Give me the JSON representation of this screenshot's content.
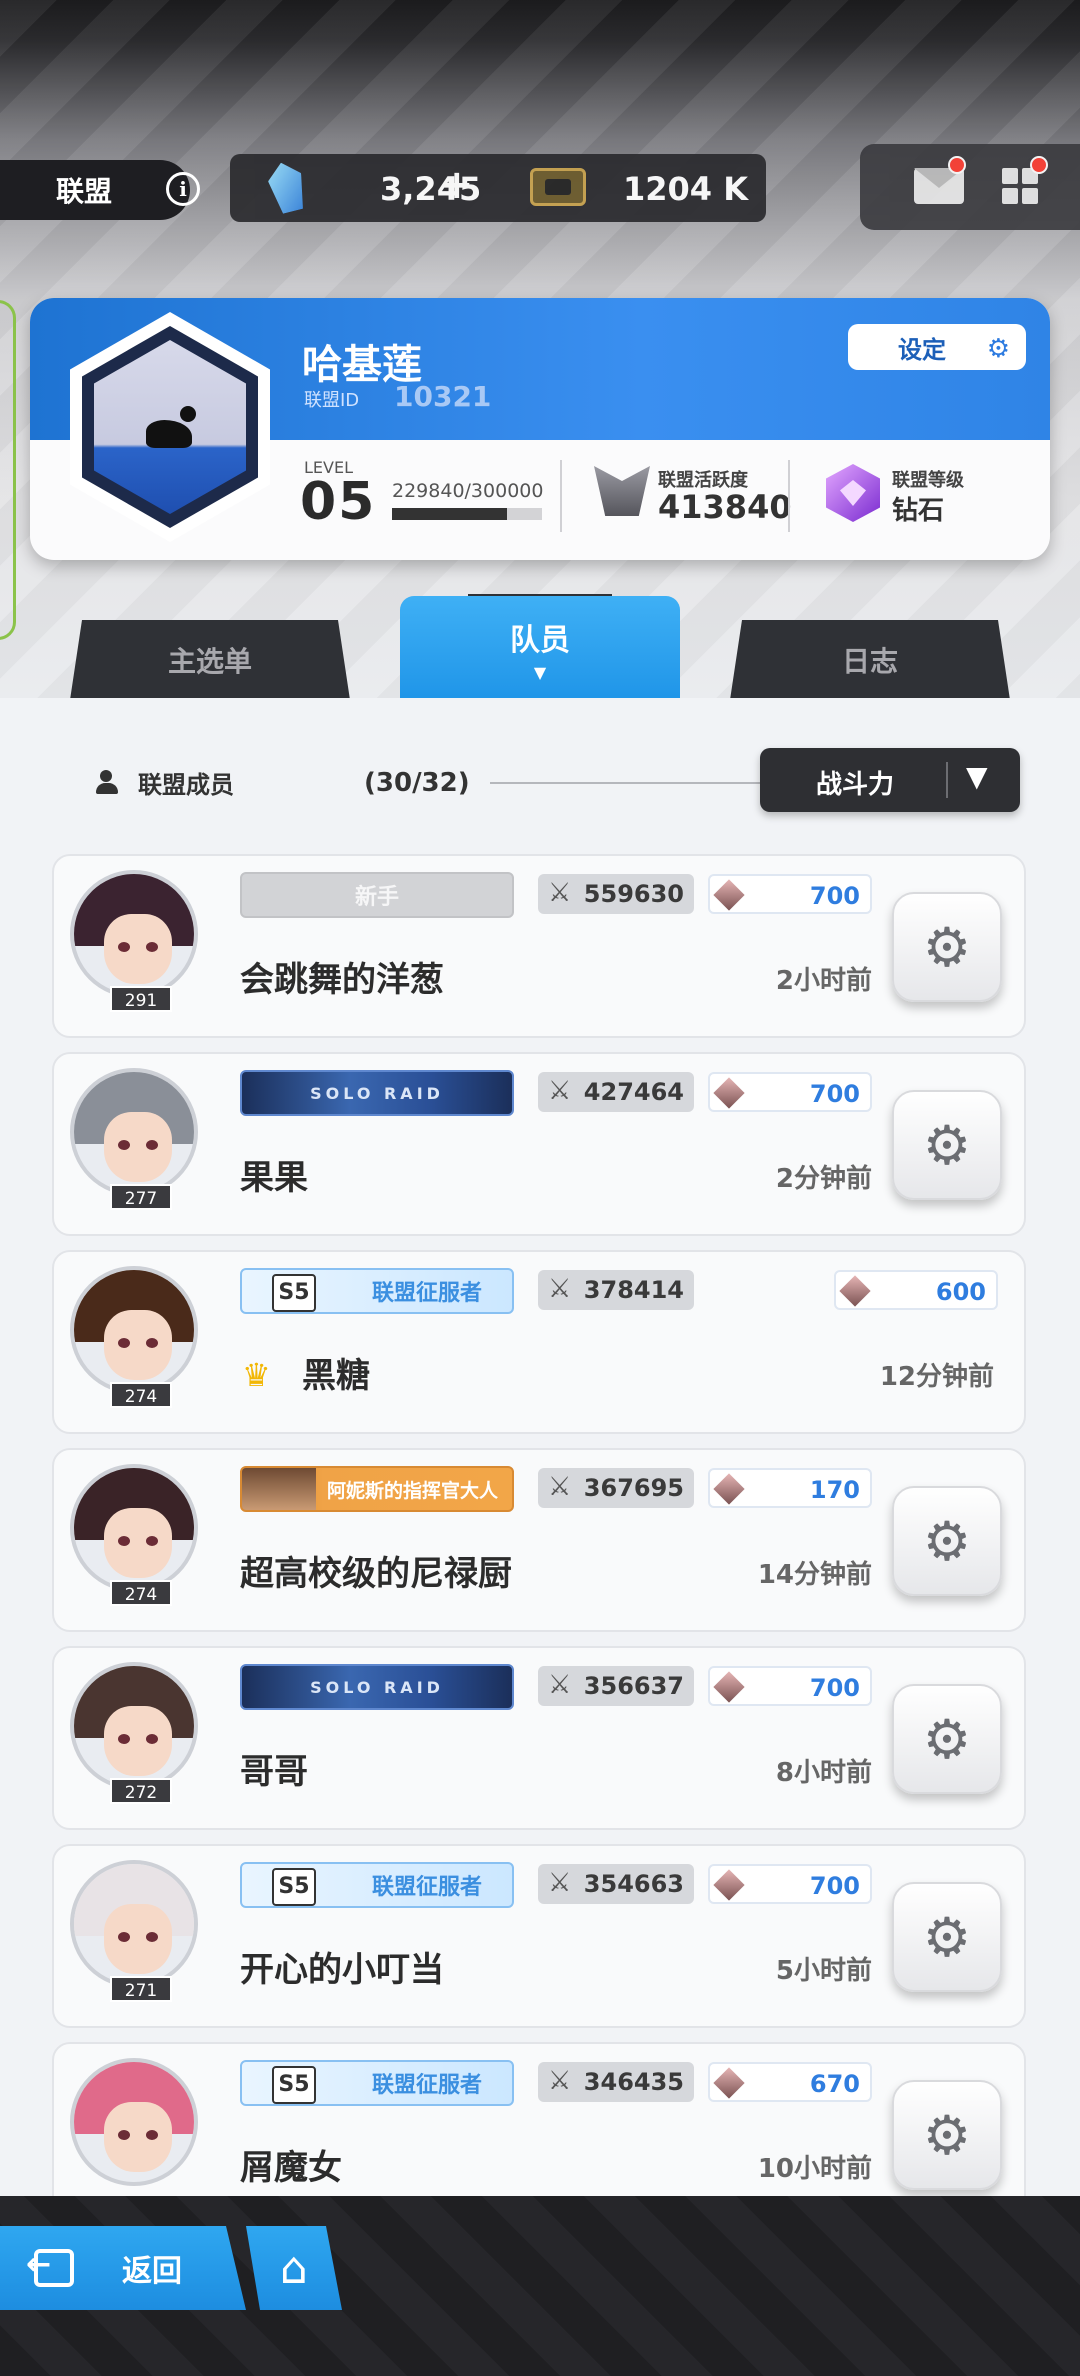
{
  "topbar": {
    "alliance_label": "联盟",
    "info_glyph": "i",
    "gems": "3,245",
    "gems_plus": "+",
    "tickets": "1204 K",
    "icons": [
      "info-icon",
      "gem-icon",
      "ticket-icon",
      "mail-icon",
      "menu-grid-icon"
    ],
    "notification_color": "#ff3b30"
  },
  "alliance": {
    "name": "哈基莲",
    "id_label": "联盟ID",
    "id": "10321",
    "settings_label": "设定",
    "level_label": "LEVEL",
    "level": "05",
    "exp_text": "229840/300000",
    "exp_progress": 0.766,
    "activity_label": "联盟活跃度",
    "activity_value": "413840",
    "rank_label": "联盟等级",
    "rank_value": "钻石",
    "accent_color": "#2a86e6"
  },
  "tabs": [
    {
      "label": "主选单",
      "active": false
    },
    {
      "label": "队员",
      "active": true
    },
    {
      "label": "日志",
      "active": false
    }
  ],
  "members_header": {
    "title": "联盟成员",
    "count": "(30/32)",
    "sort_label": "战斗力"
  },
  "members": [
    {
      "avatar_level": "291",
      "badge": "新手",
      "badge_type": "novice",
      "power": "559630",
      "contribution": "700",
      "name": "会跳舞的洋葱",
      "last_seen": "2小时前",
      "leader": false
    },
    {
      "avatar_level": "277",
      "badge": "SOLO RAID",
      "badge_type": "raid",
      "power": "427464",
      "contribution": "700",
      "name": "果果",
      "last_seen": "2分钟前",
      "leader": false
    },
    {
      "avatar_level": "274",
      "badge": "联盟征服者",
      "badge_type": "conq",
      "power": "378414",
      "contribution": "600",
      "name": "黑糖",
      "last_seen": "12分钟前",
      "leader": true
    },
    {
      "avatar_level": "274",
      "badge": "阿妮斯的指挥官大人",
      "badge_type": "annis",
      "power": "367695",
      "contribution": "170",
      "name": "超高校级的尼禄厨",
      "last_seen": "14分钟前",
      "leader": false
    },
    {
      "avatar_level": "272",
      "badge": "SOLO RAID",
      "badge_type": "raid",
      "power": "356637",
      "contribution": "700",
      "name": "哥哥",
      "last_seen": "8小时前",
      "leader": false
    },
    {
      "avatar_level": "271",
      "badge": "联盟征服者",
      "badge_type": "conq",
      "power": "354663",
      "contribution": "700",
      "name": "开心的小叮当",
      "last_seen": "5小时前",
      "leader": false
    },
    {
      "avatar_level": "",
      "badge": "联盟征服者",
      "badge_type": "conq",
      "power": "346435",
      "contribution": "670",
      "name": "屑魔女",
      "last_seen": "10小时前",
      "leader": false
    }
  ],
  "bottom": {
    "back_label": "返回",
    "icons": [
      "back-icon",
      "home-icon"
    ]
  }
}
